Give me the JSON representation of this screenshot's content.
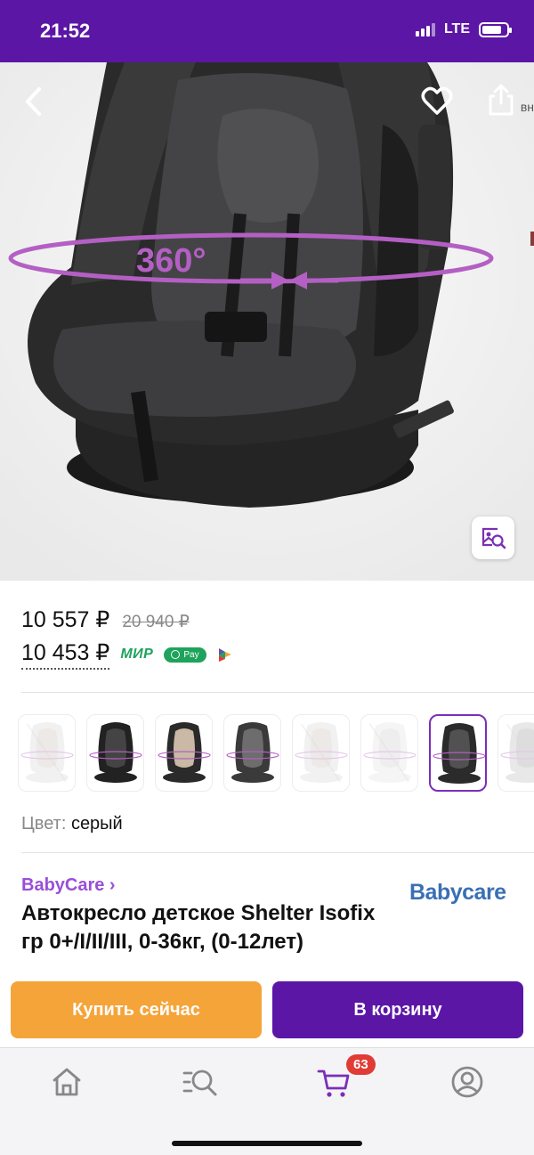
{
  "status_bar": {
    "time": "21:52",
    "network": "LTE"
  },
  "hero": {
    "rotation_text": "360°",
    "share_partial_text": "вн"
  },
  "price": {
    "current": "10 557 ₽",
    "old": "20 940 ₽",
    "card_price": "10 453 ₽",
    "payment_badges": [
      "МИР",
      "Pay"
    ]
  },
  "thumbnails": [
    {
      "variant": "light",
      "available": false,
      "selected": false
    },
    {
      "variant": "black",
      "available": true,
      "selected": false
    },
    {
      "variant": "beige",
      "available": true,
      "selected": false
    },
    {
      "variant": "gray",
      "available": true,
      "selected": false
    },
    {
      "variant": "light",
      "available": false,
      "selected": false
    },
    {
      "variant": "white",
      "available": false,
      "selected": false
    },
    {
      "variant": "dark",
      "available": true,
      "selected": true
    },
    {
      "variant": "silver",
      "available": false,
      "selected": false
    }
  ],
  "color": {
    "label": "Цвет:",
    "value": "серый"
  },
  "brand": {
    "link": "BabyCare ›",
    "logo_text": "Babycare"
  },
  "product": {
    "title": "Автокресло детское Shelter Isofix гр 0+/I/II/III, 0-36кг, (0-12лет)"
  },
  "actions": {
    "buy_now": "Купить сейчас",
    "add_to_cart": "В корзину"
  },
  "tabbar": {
    "cart_count": "63"
  },
  "colors": {
    "brand_purple": "#5b16a6",
    "accent_orange": "#f5a43a",
    "badge_red": "#e23b35"
  }
}
